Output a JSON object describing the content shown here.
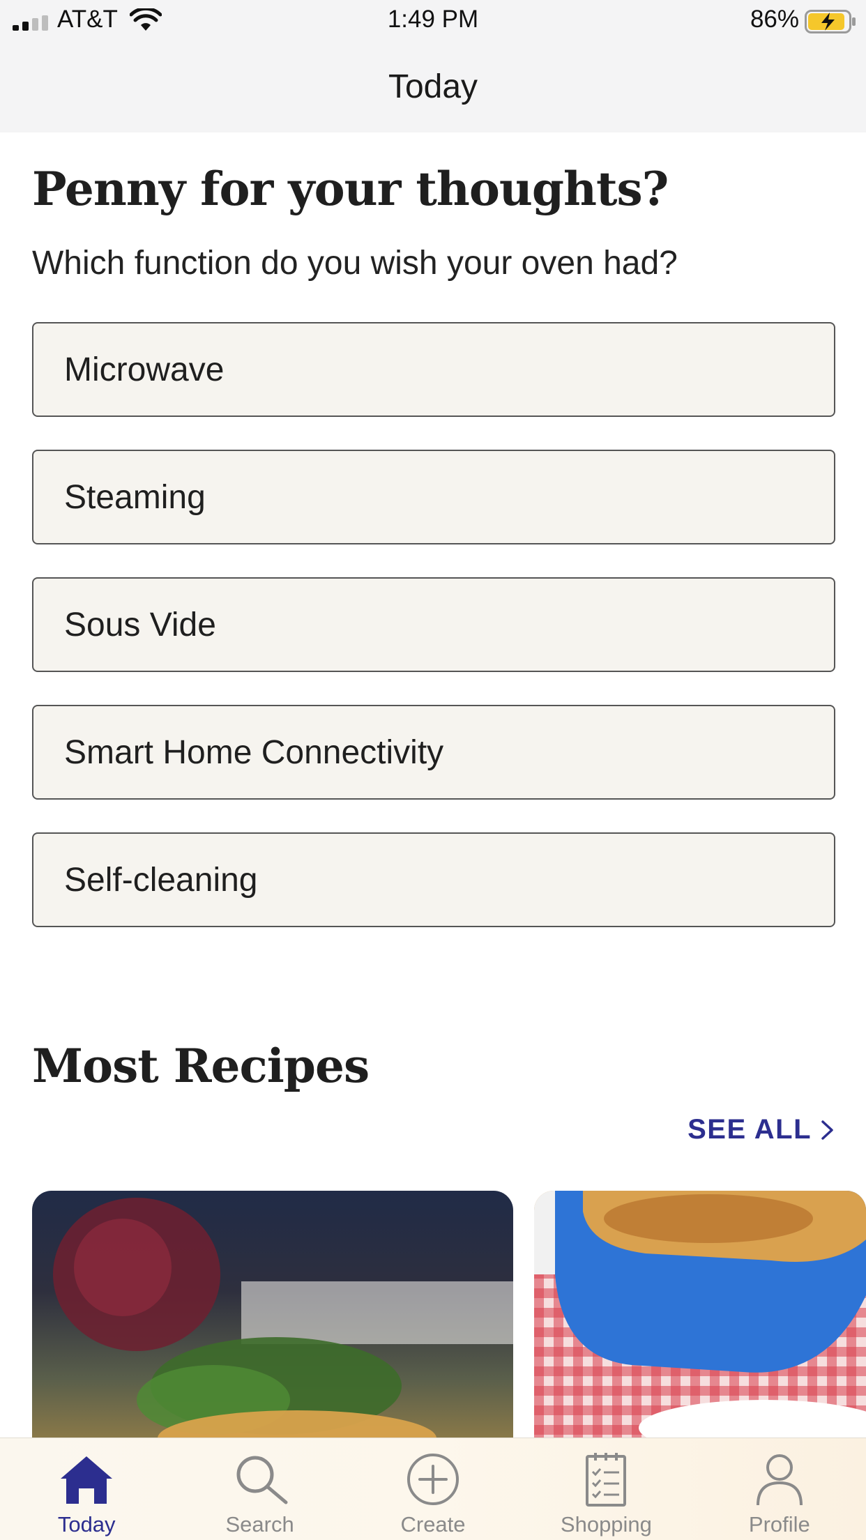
{
  "status_bar": {
    "carrier": "AT&T",
    "time": "1:49 PM",
    "battery": "86%"
  },
  "nav": {
    "title": "Today"
  },
  "poll": {
    "title": "Penny for your thoughts?",
    "question": "Which function do you wish your oven had?",
    "options": [
      "Microwave",
      "Steaming",
      "Sous Vide",
      "Smart Home Connectivity",
      "Self-cleaning"
    ]
  },
  "recipes": {
    "title": "Most Recipes",
    "see_all": "SEE ALL"
  },
  "tab_bar": {
    "active_color": "#2c2e8f",
    "items": [
      {
        "label": "Today",
        "icon": "home-icon",
        "active": true
      },
      {
        "label": "Search",
        "icon": "search-icon",
        "active": false
      },
      {
        "label": "Create",
        "icon": "plus-circle-icon",
        "active": false
      },
      {
        "label": "Shopping",
        "icon": "shopping-list-icon",
        "active": false
      },
      {
        "label": "Profile",
        "icon": "person-icon",
        "active": false
      }
    ]
  }
}
